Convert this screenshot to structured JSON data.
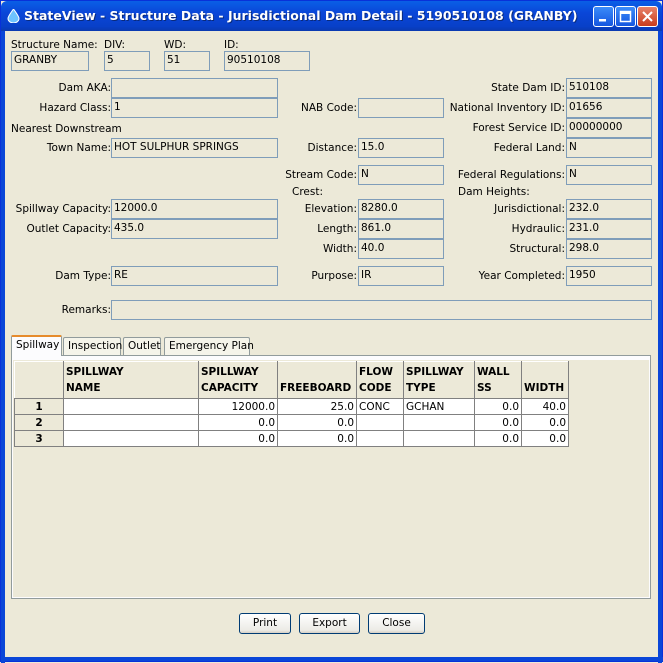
{
  "window": {
    "title": "StateView - Structure Data - Jurisdictional Dam Detail - 5190510108 (GRANBY)",
    "accent_color": "#0a46d8"
  },
  "header": {
    "structure_name_label": "Structure Name:",
    "structure_name": "GRANBY",
    "div_label": "DIV:",
    "div": "5",
    "wd_label": "WD:",
    "wd": "51",
    "id_label": "ID:",
    "id": "90510108"
  },
  "left": {
    "dam_aka_label": "Dam AKA:",
    "dam_aka": "",
    "hazard_class_label": "Hazard Class:",
    "hazard_class": "1",
    "nearest_downstream_label": "Nearest Downstream",
    "town_name_label": "Town Name:",
    "town_name": "HOT SULPHUR SPRINGS",
    "spillway_capacity_label": "Spillway Capacity:",
    "spillway_capacity": "12000.0",
    "outlet_capacity_label": "Outlet Capacity:",
    "outlet_capacity": "435.0",
    "dam_type_label": "Dam Type:",
    "dam_type": "RE",
    "remarks_label": "Remarks:",
    "remarks": ""
  },
  "middle": {
    "nab_code_label": "NAB Code:",
    "nab_code": "",
    "distance_label": "Distance:",
    "distance": "15.0",
    "stream_code_label": "Stream Code:",
    "stream_code": "N",
    "crest_label": "Crest:",
    "elevation_label": "Elevation:",
    "elevation": "8280.0",
    "length_label": "Length:",
    "length": "861.0",
    "width_label": "Width:",
    "width": "40.0",
    "purpose_label": "Purpose:",
    "purpose": "IR"
  },
  "right": {
    "state_dam_id_label": "State Dam ID:",
    "state_dam_id": "510108",
    "national_inventory_id_label": "National Inventory ID:",
    "national_inventory_id": "01656",
    "forest_service_id_label": "Forest Service ID:",
    "forest_service_id": "00000000",
    "federal_land_label": "Federal Land:",
    "federal_land": "N",
    "federal_regulations_label": "Federal Regulations:",
    "federal_regulations": "N",
    "dam_heights_label": "Dam Heights:",
    "jurisdictional_label": "Jurisdictional:",
    "jurisdictional": "232.0",
    "hydraulic_label": "Hydraulic:",
    "hydraulic": "231.0",
    "structural_label": "Structural:",
    "structural": "298.0",
    "year_completed_label": "Year Completed:",
    "year_completed": "1950"
  },
  "tabs": [
    "Spillway",
    "Inspection",
    "Outlet",
    "Emergency Plan"
  ],
  "table": {
    "columns": [
      {
        "l1": "SPILLWAY",
        "l2": "NAME"
      },
      {
        "l1": "SPILLWAY",
        "l2": "CAPACITY"
      },
      {
        "l1": "",
        "l2": "FREEBOARD"
      },
      {
        "l1": "FLOW",
        "l2": "CODE"
      },
      {
        "l1": "SPILLWAY",
        "l2": "TYPE"
      },
      {
        "l1": "WALL",
        "l2": "SS"
      },
      {
        "l1": "",
        "l2": "WIDTH"
      }
    ],
    "rows": [
      {
        "n": "1",
        "name": "",
        "capacity": "12000.0",
        "freeboard": "25.0",
        "flow_code": "CONC",
        "type": "GCHAN",
        "walls": "0.0",
        "width": "40.0"
      },
      {
        "n": "2",
        "name": "",
        "capacity": "0.0",
        "freeboard": "0.0",
        "flow_code": "",
        "type": "",
        "walls": "0.0",
        "width": "0.0"
      },
      {
        "n": "3",
        "name": "",
        "capacity": "0.0",
        "freeboard": "0.0",
        "flow_code": "",
        "type": "",
        "walls": "0.0",
        "width": "0.0"
      }
    ]
  },
  "buttons": {
    "print": "Print",
    "export": "Export",
    "close": "Close"
  }
}
